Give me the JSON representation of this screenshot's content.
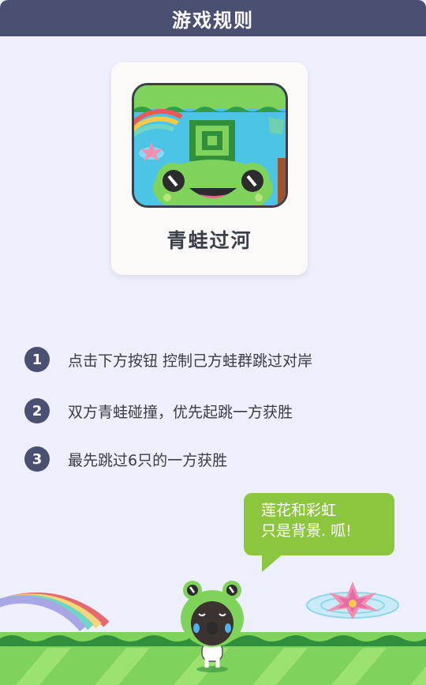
{
  "header": {
    "title": "游戏规则"
  },
  "game": {
    "name": "青蛙过河"
  },
  "rules": [
    {
      "num": "1",
      "text": "点击下方按钮  控制己方蛙群跳过对岸"
    },
    {
      "num": "2",
      "text": "双方青蛙碰撞，优先起跳一方获胜"
    },
    {
      "num": "3",
      "text": "最先跳过6只的一方获胜"
    }
  ],
  "mascot": {
    "speech_line1": "莲花和彩虹",
    "speech_line2": "只是背景. 呱!"
  }
}
